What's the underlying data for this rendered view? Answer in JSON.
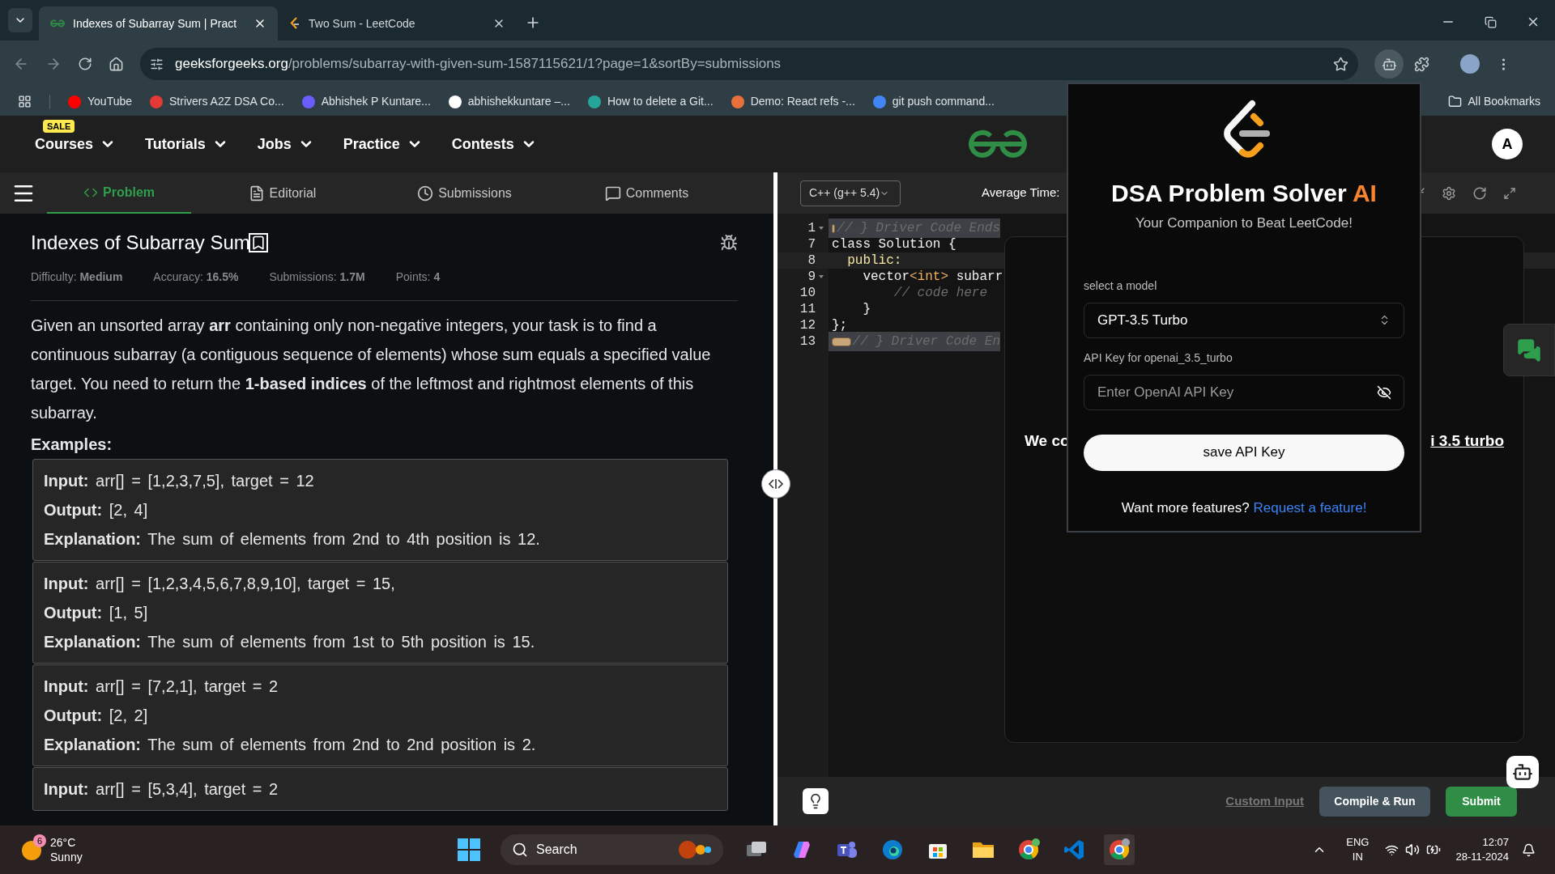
{
  "browser": {
    "tabs": [
      {
        "title": "Indexes of Subarray Sum | Pract",
        "selected": true
      },
      {
        "title": "Two Sum - LeetCode",
        "selected": false
      }
    ],
    "url": {
      "host": "geeksforgeeks.org",
      "path": "/problems/subarray-with-given-sum-1587115621/1?page=1&sortBy=submissions"
    },
    "bookmarks": [
      {
        "label": "YouTube",
        "color": "#ff0000"
      },
      {
        "label": "Strivers A2Z DSA Co...",
        "color": "#e53935"
      },
      {
        "label": "Abhishek P Kuntare...",
        "color": "#6a5cff"
      },
      {
        "label": "abhishekkuntare –...",
        "color": "#ffffff"
      },
      {
        "label": "How to delete a Git...",
        "color": "#26a69a"
      },
      {
        "label": "Demo: React refs -...",
        "color": "#e8703a"
      },
      {
        "label": "git push command...",
        "color": "#4285f4"
      }
    ],
    "all_bookmarks": "All Bookmarks"
  },
  "site_nav": {
    "items": [
      {
        "label": "Courses",
        "badge": "SALE"
      },
      {
        "label": "Tutorials"
      },
      {
        "label": "Jobs"
      },
      {
        "label": "Practice"
      },
      {
        "label": "Contests"
      }
    ],
    "avatar": "A"
  },
  "problem_tabs": [
    {
      "label": "Problem",
      "selected": true
    },
    {
      "label": "Editorial",
      "selected": false
    },
    {
      "label": "Submissions",
      "selected": false
    },
    {
      "label": "Comments",
      "selected": false
    }
  ],
  "problem": {
    "title": "Indexes of Subarray Sum",
    "meta": [
      "Difficulty: **Medium**",
      "Accuracy: **16.5%**",
      "Submissions: **1.7M**",
      "Points: **4**"
    ],
    "description": "Given an unsorted array **arr** containing only non-negative integers, your task is to find a continuous subarray (a contiguous sequence of elements) whose sum equals a specified value target. You need to return the **1-based indices** of the leftmost and rightmost elements of this subarray.",
    "examples_heading": "Examples:",
    "examples": [
      [
        "**Input:** arr[] = [1,2,3,7,5], target = 12",
        "**Output:** [2, 4]",
        "**Explanation:** The sum of elements from 2nd to 4th position is 12."
      ],
      [
        "**Input:** arr[] = [1,2,3,4,5,6,7,8,9,10], target = 15,",
        "**Output:** [1, 5]",
        "**Explanation:** The sum of elements from 1st to 5th position is 15."
      ],
      [
        "**Input:** arr[] = [7,2,1], target = 2",
        "**Output:** [2, 2]",
        "**Explanation:** The sum of elements from 2nd to 2nd position is 2."
      ],
      [
        "**Input:** arr[] = [5,3,4], target = 2"
      ]
    ]
  },
  "editor": {
    "language": "C++ (g++ 5.4)",
    "average_time": "Average Time:",
    "lines": [
      {
        "num": "1",
        "kind": "folded",
        "fold": true,
        "active": false,
        "segments": [
          {
            "kind": "comment",
            "t": "// } Driver Code Ends"
          }
        ]
      },
      {
        "num": "7",
        "kind": "code",
        "fold": false,
        "active": false,
        "segments": [
          {
            "kind": "plain",
            "t": "class Solution {"
          }
        ]
      },
      {
        "num": "8",
        "kind": "code",
        "fold": false,
        "active": true,
        "segments": [
          {
            "kind": "keyword",
            "t": "  public:"
          }
        ]
      },
      {
        "num": "9",
        "kind": "code",
        "fold": true,
        "active": false,
        "segments": [
          {
            "kind": "plain",
            "t": "    vector"
          },
          {
            "kind": "type",
            "t": "<int>"
          },
          {
            "kind": "plain",
            "t": " subarr"
          }
        ]
      },
      {
        "num": "10",
        "kind": "code",
        "fold": false,
        "active": false,
        "segments": [
          {
            "kind": "comment",
            "t": "        // code here"
          }
        ]
      },
      {
        "num": "11",
        "kind": "code",
        "fold": false,
        "active": false,
        "segments": [
          {
            "kind": "plain",
            "t": "    }"
          }
        ]
      },
      {
        "num": "12",
        "kind": "code",
        "fold": false,
        "active": false,
        "segments": [
          {
            "kind": "plain",
            "t": "};"
          }
        ]
      },
      {
        "num": "13",
        "kind": "folded",
        "fold": false,
        "active": false,
        "segments": [
          {
            "kind": "comment",
            "t": "// } Driver Code En"
          }
        ]
      }
    ],
    "dialog_left": "We co",
    "dialog_right": "i 3.5 turbo",
    "custom_input": "Custom Input",
    "compile_run": "Compile & Run",
    "submit": "Submit"
  },
  "popup": {
    "title": "DSA Problem Solver",
    "title_accent": "AI",
    "subtitle": "Your Companion to Beat LeetCode!",
    "model_label": "select a model",
    "model": "GPT-3.5 Turbo",
    "key_label": "API Key for openai_3.5_turbo",
    "key_placeholder": "Enter OpenAI API Key",
    "save": "save API Key",
    "more": "Want more features?",
    "request": "Request a feature!"
  },
  "taskbar": {
    "weather_badge": "6",
    "temperature": "26°C",
    "condition": "Sunny",
    "search": "Search",
    "lang": "ENG",
    "region": "IN",
    "time": "12:07",
    "date": "28-11-2024"
  }
}
